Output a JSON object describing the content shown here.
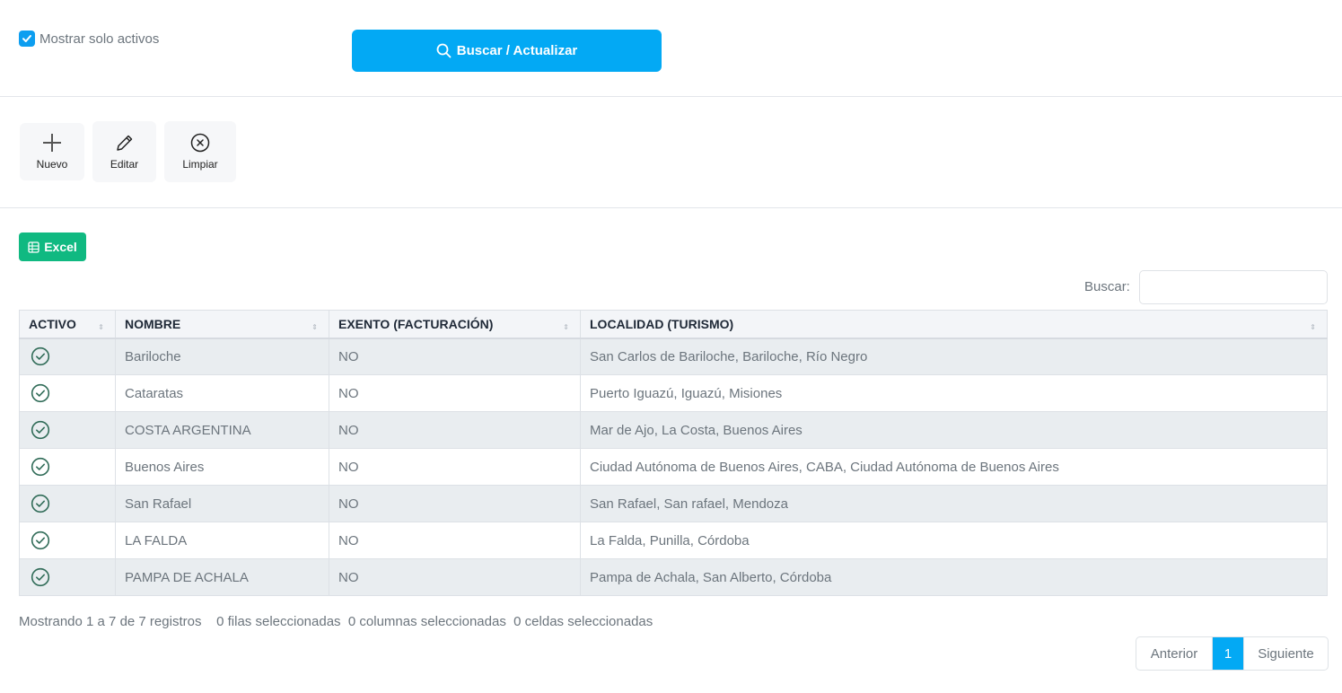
{
  "filters": {
    "active_only_label": "Mostrar solo activos",
    "active_only_checked": true,
    "search_button_label": "Buscar / Actualizar"
  },
  "toolbar": {
    "new_label": "Nuevo",
    "edit_label": "Editar",
    "clear_label": "Limpiar"
  },
  "export": {
    "excel_label": "Excel"
  },
  "search": {
    "label": "Buscar:",
    "value": "",
    "placeholder": ""
  },
  "table": {
    "columns": [
      "ACTIVO",
      "NOMBRE",
      "EXENTO (FACTURACIÓN)",
      "LOCALIDAD (TURISMO)"
    ],
    "rows": [
      {
        "activo": true,
        "nombre": "Bariloche",
        "exento": "NO",
        "localidad": "San Carlos de Bariloche, Bariloche, Río Negro"
      },
      {
        "activo": true,
        "nombre": "Cataratas",
        "exento": "NO",
        "localidad": "Puerto Iguazú, Iguazú, Misiones"
      },
      {
        "activo": true,
        "nombre": "COSTA ARGENTINA",
        "exento": "NO",
        "localidad": "Mar de Ajo, La Costa, Buenos Aires"
      },
      {
        "activo": true,
        "nombre": "Buenos Aires",
        "exento": "NO",
        "localidad": "Ciudad Autónoma de Buenos Aires, CABA, Ciudad Autónoma de Buenos Aires"
      },
      {
        "activo": true,
        "nombre": "San Rafael",
        "exento": "NO",
        "localidad": "San Rafael, San rafael, Mendoza"
      },
      {
        "activo": true,
        "nombre": "LA FALDA",
        "exento": "NO",
        "localidad": "La Falda, Punilla, Córdoba"
      },
      {
        "activo": true,
        "nombre": "PAMPA DE ACHALA",
        "exento": "NO",
        "localidad": "Pampa de Achala, San Alberto, Córdoba"
      }
    ]
  },
  "footer": {
    "showing": "Mostrando 1 a 7 de 7 registros",
    "rows_selected": "0 filas seleccionadas",
    "cols_selected": "0 columnas seleccionadas",
    "cells_selected": "0 celdas seleccionadas"
  },
  "pagination": {
    "prev_label": "Anterior",
    "current_page": "1",
    "next_label": "Siguiente"
  },
  "colors": {
    "accent": "#03a9f4",
    "excel": "#10b981",
    "check": "#0d9ef0",
    "active_icon": "#2f6b57"
  }
}
